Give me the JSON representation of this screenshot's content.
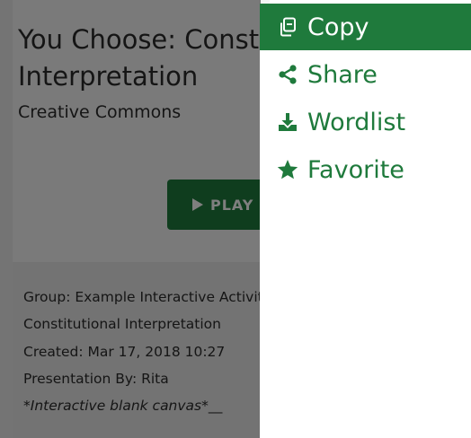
{
  "card": {
    "title_line1": "You Choose: Constitutional",
    "title_line2": "Interpretation",
    "license": "Creative Commons",
    "play_label": "PLAY",
    "meta": {
      "group": "Group: Example Interactive Activities",
      "topic": "Constitutional Interpretation",
      "created": "Created: Mar 17, 2018 10:27",
      "presenter": "Presentation By: Rita",
      "note": "*Interactive blank canvas*__"
    }
  },
  "menu": {
    "items": [
      {
        "label": "Copy",
        "icon": "copy-icon",
        "active": true
      },
      {
        "label": "Share",
        "icon": "share-icon",
        "active": false
      },
      {
        "label": "Wordlist",
        "icon": "download-icon",
        "active": false
      },
      {
        "label": "Favorite",
        "icon": "star-icon",
        "active": false
      }
    ]
  },
  "colors": {
    "accent": "#1f7a3c",
    "overlay": "rgba(0,0,0,0.5)",
    "menu_bg": "#ffffff"
  }
}
